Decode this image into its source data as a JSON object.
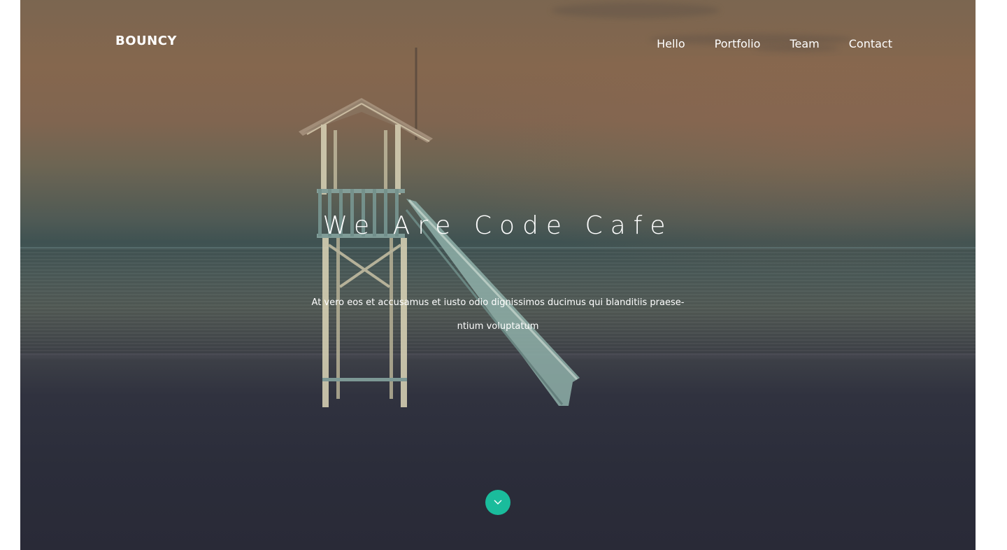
{
  "header": {
    "brand": "BOUNCY",
    "nav": [
      {
        "label": "Hello"
      },
      {
        "label": "Portfolio"
      },
      {
        "label": "Team"
      },
      {
        "label": "Contact"
      }
    ]
  },
  "hero": {
    "title": "We Are Code Cafe",
    "lede_line1": "At vero eos et accusamus et iusto odio dignissimos ducimus qui blanditiis praese-",
    "lede_line2": "ntium voluptatum",
    "scroll_icon": "chevron-down-icon",
    "accent": "#1abc9c",
    "background_image": "lifeguard-tower-on-beach-at-dusk"
  }
}
